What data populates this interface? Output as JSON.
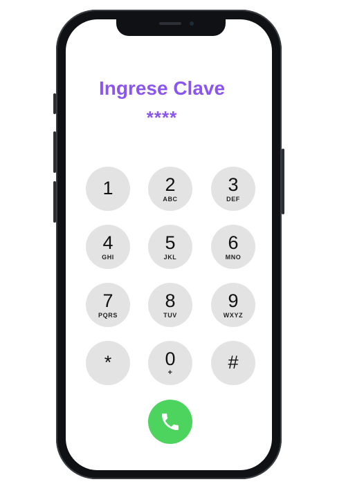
{
  "screen": {
    "title": "Ingrese Clave",
    "pin_display": "****"
  },
  "keypad": {
    "keys": [
      {
        "digit": "1",
        "letters": ""
      },
      {
        "digit": "2",
        "letters": "ABC"
      },
      {
        "digit": "3",
        "letters": "DEF"
      },
      {
        "digit": "4",
        "letters": "GHI"
      },
      {
        "digit": "5",
        "letters": "JKL"
      },
      {
        "digit": "6",
        "letters": "MNO"
      },
      {
        "digit": "7",
        "letters": "PQRS"
      },
      {
        "digit": "8",
        "letters": "TUV"
      },
      {
        "digit": "9",
        "letters": "WXYZ"
      },
      {
        "digit": "*",
        "letters": ""
      },
      {
        "digit": "0",
        "letters": "+"
      },
      {
        "digit": "#",
        "letters": ""
      }
    ],
    "call_icon": "phone-icon"
  },
  "colors": {
    "accent": "#8b55f2",
    "key_background": "#e3e3e3",
    "call_green": "#4cd45f"
  }
}
